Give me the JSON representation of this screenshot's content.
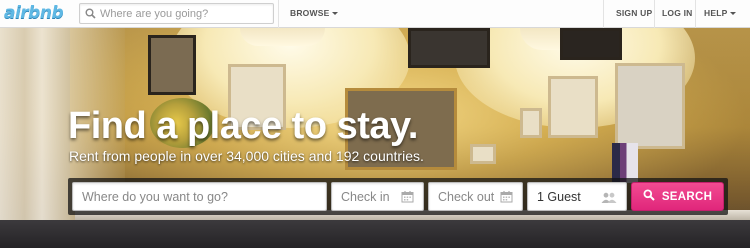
{
  "header": {
    "logo_text": "airbnb",
    "search_placeholder": "Where are you going?",
    "nav": {
      "browse": "BROWSE",
      "sign_up": "SIGN UP",
      "log_in": "LOG IN",
      "help": "HELP"
    }
  },
  "hero": {
    "title": "Find a place to stay.",
    "subtitle": "Rent from people in over 34,000 cities and 192 countries."
  },
  "search": {
    "location_placeholder": "Where do you want to go?",
    "checkin_placeholder": "Check in",
    "checkout_placeholder": "Check out",
    "guests_value": "1 Guest",
    "search_label": "SEARCH"
  },
  "colors": {
    "brand_blue": "#5fb8e4",
    "search_button": "#e0267b"
  },
  "icons": {
    "top_search": "search-icon",
    "calendar": "calendar-icon",
    "guests": "users-icon",
    "search_button": "search-icon"
  }
}
